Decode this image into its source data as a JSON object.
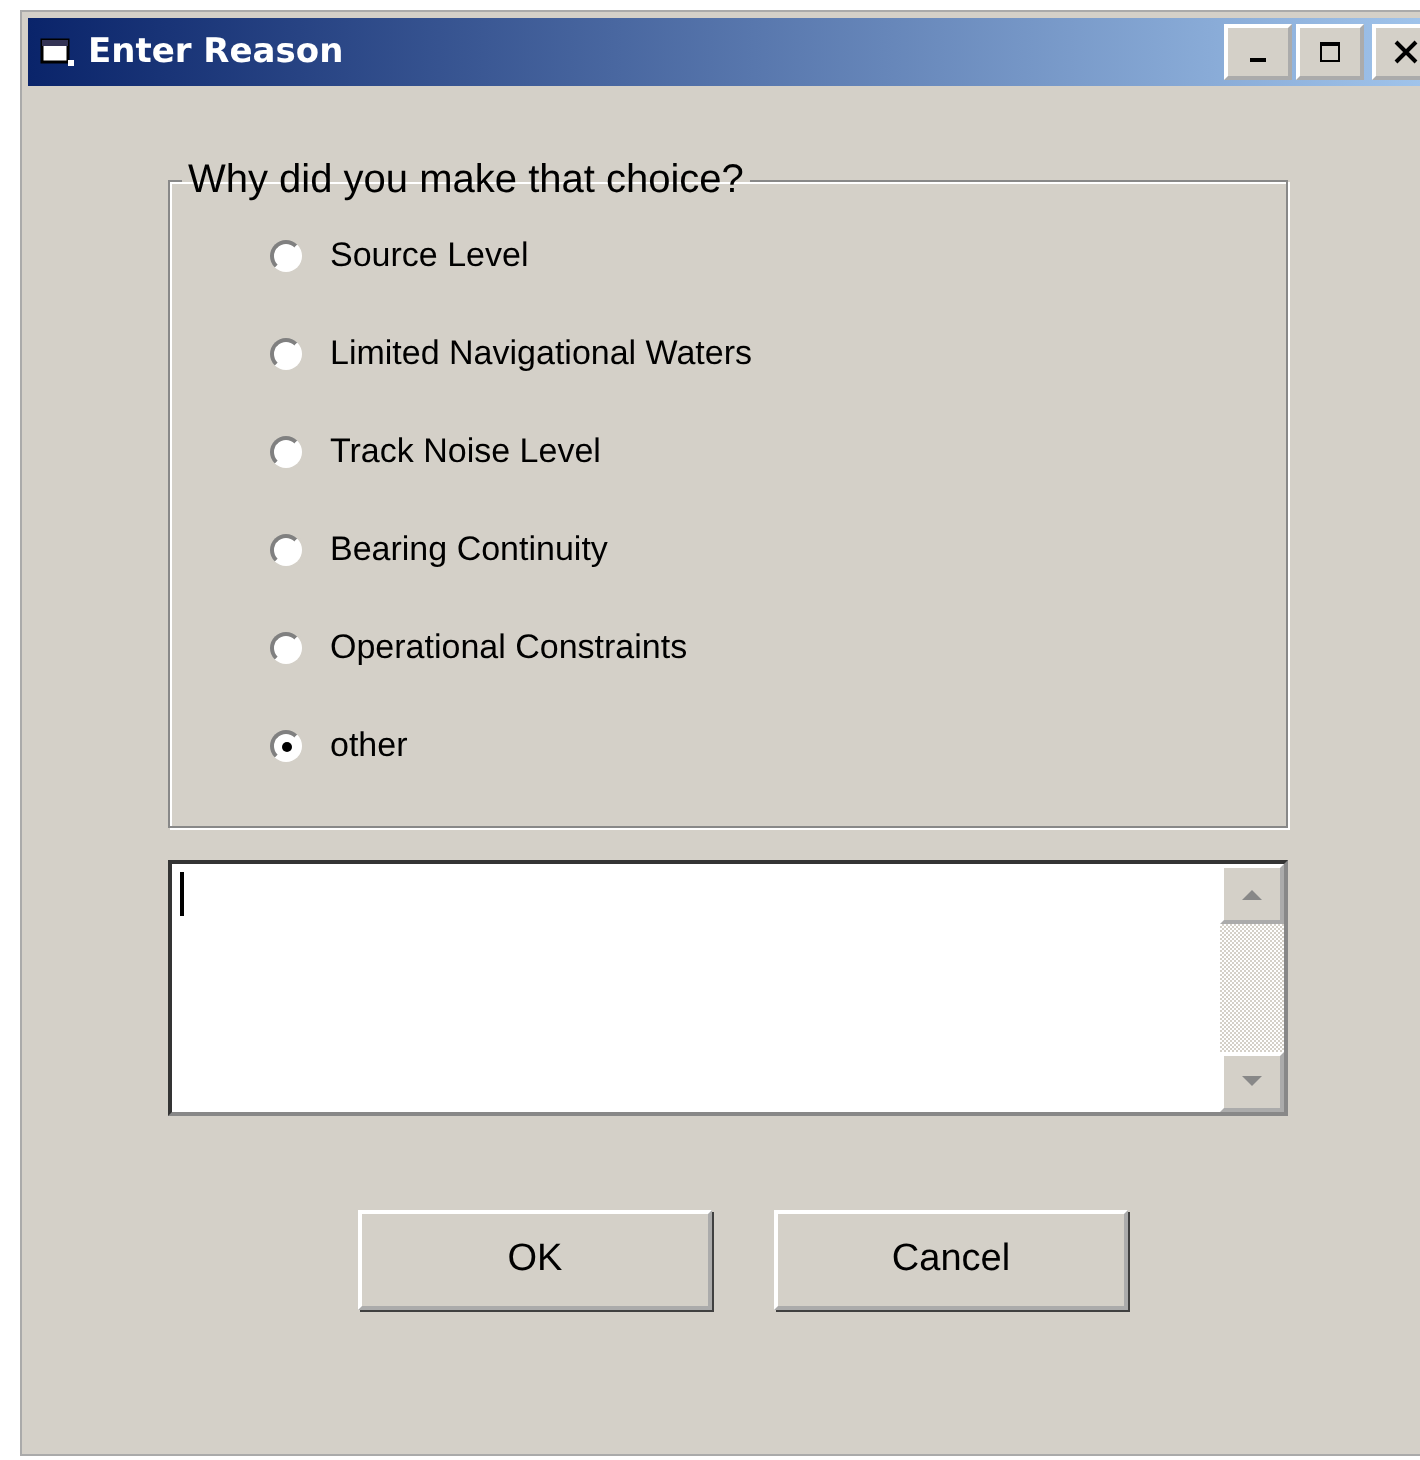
{
  "window": {
    "title": "Enter Reason"
  },
  "group": {
    "legend": "Why did you make that choice?",
    "options": [
      {
        "label": "Source Level",
        "selected": false
      },
      {
        "label": "Limited Navigational Waters",
        "selected": false
      },
      {
        "label": "Track Noise Level",
        "selected": false
      },
      {
        "label": "Bearing Continuity",
        "selected": false
      },
      {
        "label": "Operational Constraints",
        "selected": false
      },
      {
        "label": "other",
        "selected": true
      }
    ]
  },
  "buttons": [
    {
      "label": "OK"
    },
    {
      "label": "Cancel"
    }
  ]
}
